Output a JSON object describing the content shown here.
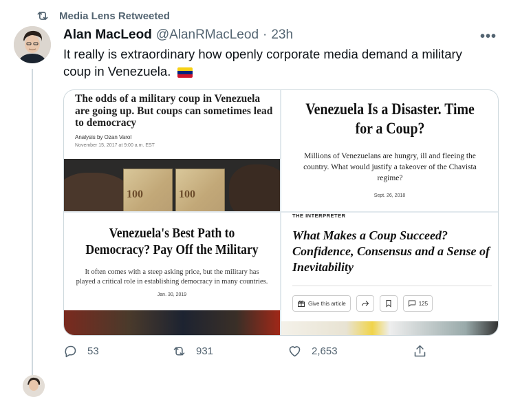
{
  "retweet_context": {
    "label": "Media Lens Retweeted"
  },
  "tweet": {
    "author_name": "Alan MacLeod",
    "handle": "@AlanRMacLeod",
    "separator": "·",
    "time": "23h",
    "more_label": "•••",
    "text": "It really is extraordinary how openly corporate media demand a military coup in Venezuela."
  },
  "media": {
    "tile1": {
      "headline": "The odds of a military coup in Venezuela are going up. But coups can sometimes lead to democracy",
      "byline": "Analysis by Ozan Varol",
      "date": "November 15, 2017 at 9:00 a.m. EST",
      "bill_value": "100"
    },
    "tile2": {
      "headline": "Venezuela Is a Disaster. Time for a Coup?",
      "dek": "Millions of Venezuelans are hungry, ill and fleeing the country. What would justify a takeover of the Chavista regime?",
      "date": "Sept. 26, 2018"
    },
    "tile3": {
      "headline": "Venezuela's Best Path to Democracy? Pay Off the Military",
      "dek": "It often comes with a steep asking price, but the military has played a critical role in establishing democracy in many countries.",
      "date": "Jan. 30, 2019"
    },
    "tile4": {
      "kicker": "THE INTERPRETER",
      "headline": "What Makes a Coup Succeed? Confidence, Consensus and a Sense of Inevitability",
      "gift_label": "Give this article",
      "comments_count": "125"
    }
  },
  "actions": {
    "replies": "53",
    "retweets": "931",
    "likes": "2,653"
  },
  "icons": [
    "retweet-icon",
    "more-icon",
    "reply-icon",
    "like-icon",
    "share-icon",
    "gift-icon",
    "bookmark-icon",
    "comment-icon"
  ],
  "colors": {
    "secondary_text": "#536471",
    "border": "#cfd9de"
  }
}
